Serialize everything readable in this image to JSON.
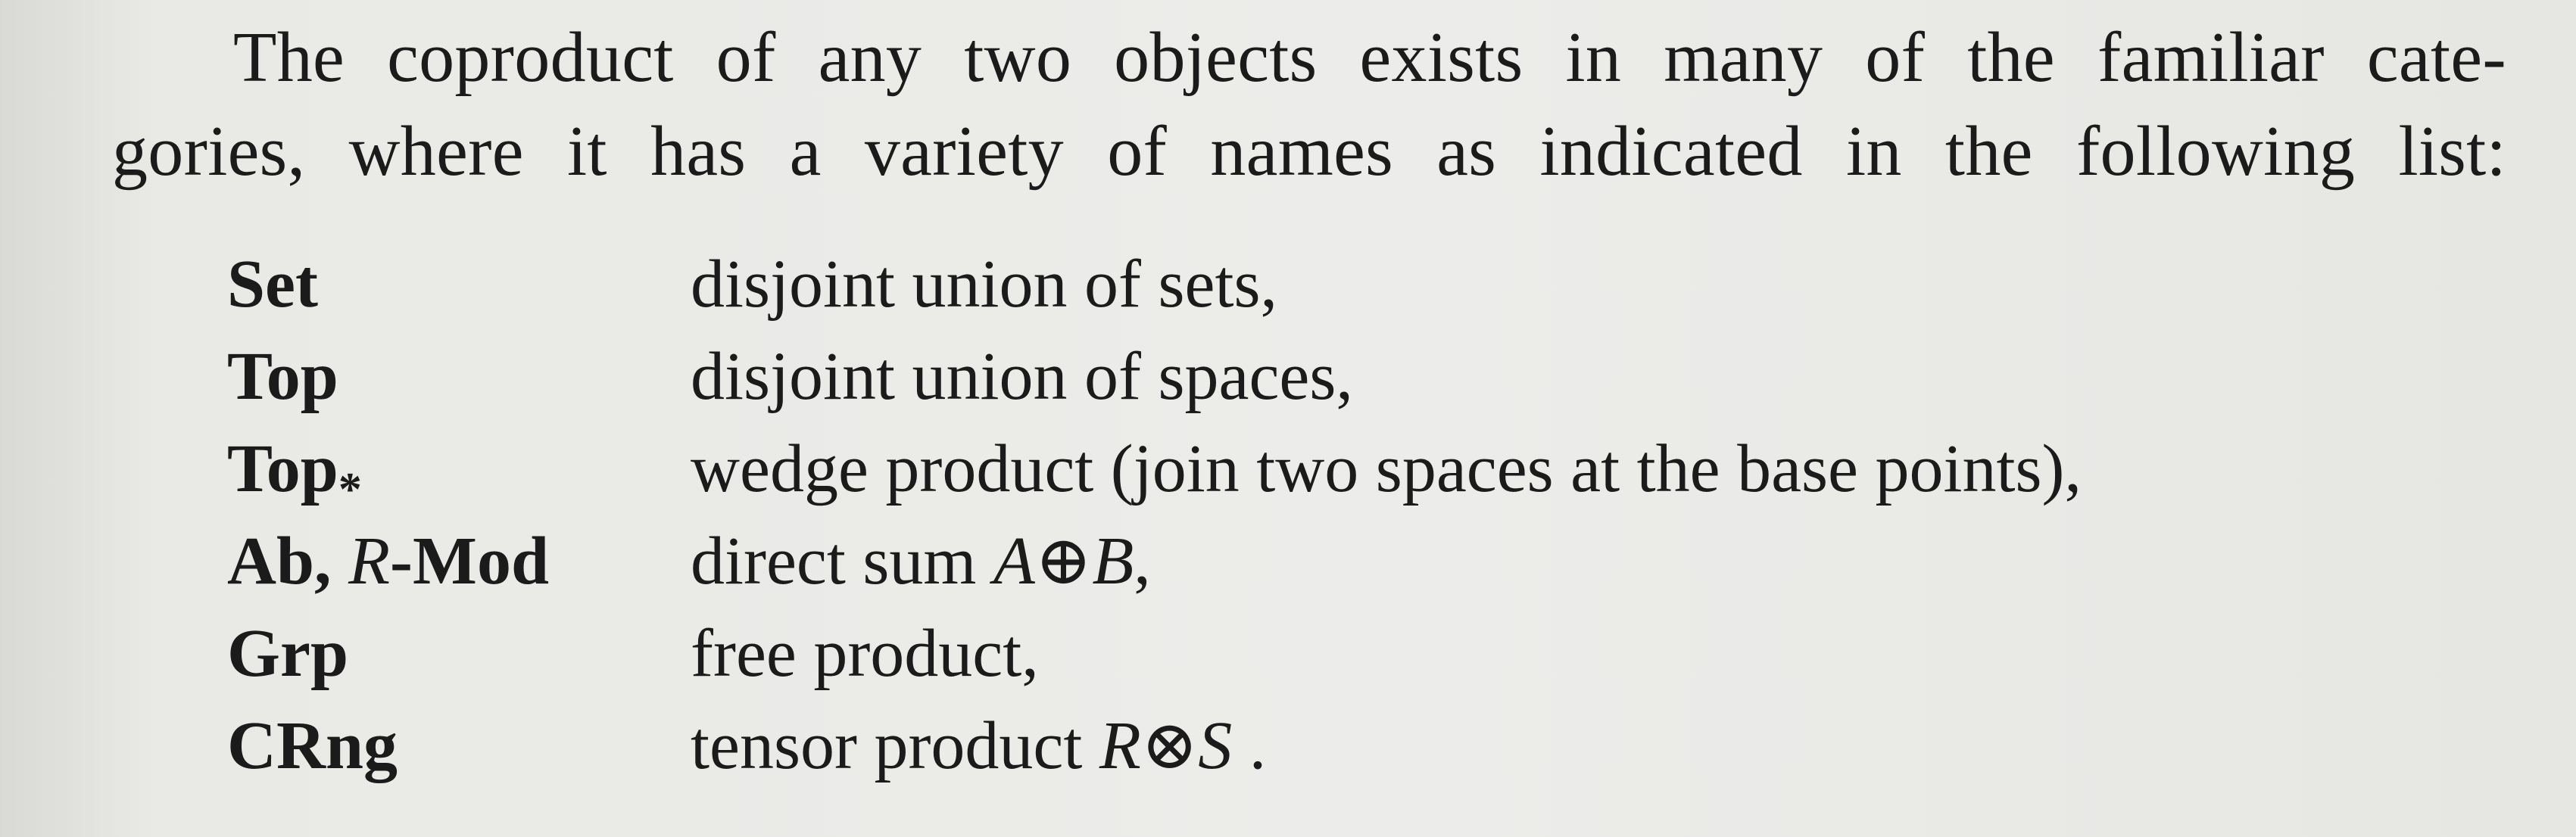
{
  "intro": {
    "line1": "The coproduct of any two objects exists in many of the familiar cate-",
    "line2": "gories, where it has a variety of names as indicated in the following list:"
  },
  "list": [
    {
      "category": "Set",
      "description": "disjoint union of sets,"
    },
    {
      "category": "Top",
      "description": "disjoint union of spaces,"
    },
    {
      "category_base": "Top",
      "category_subscript": "*",
      "description": "wedge product (join two spaces at the base points),"
    },
    {
      "category_a": "Ab, ",
      "category_ring": "R",
      "category_b": "-Mod",
      "description_prefix": "direct sum ",
      "desc_var1": "A",
      "desc_op": "⊕",
      "desc_var2": "B",
      "desc_suffix": ","
    },
    {
      "category": "Grp",
      "description": "free product,"
    },
    {
      "category": "CRng",
      "description_prefix": "tensor product ",
      "desc_var1": "R",
      "desc_op": "⊗",
      "desc_var2": "S",
      "desc_suffix": " ."
    }
  ]
}
